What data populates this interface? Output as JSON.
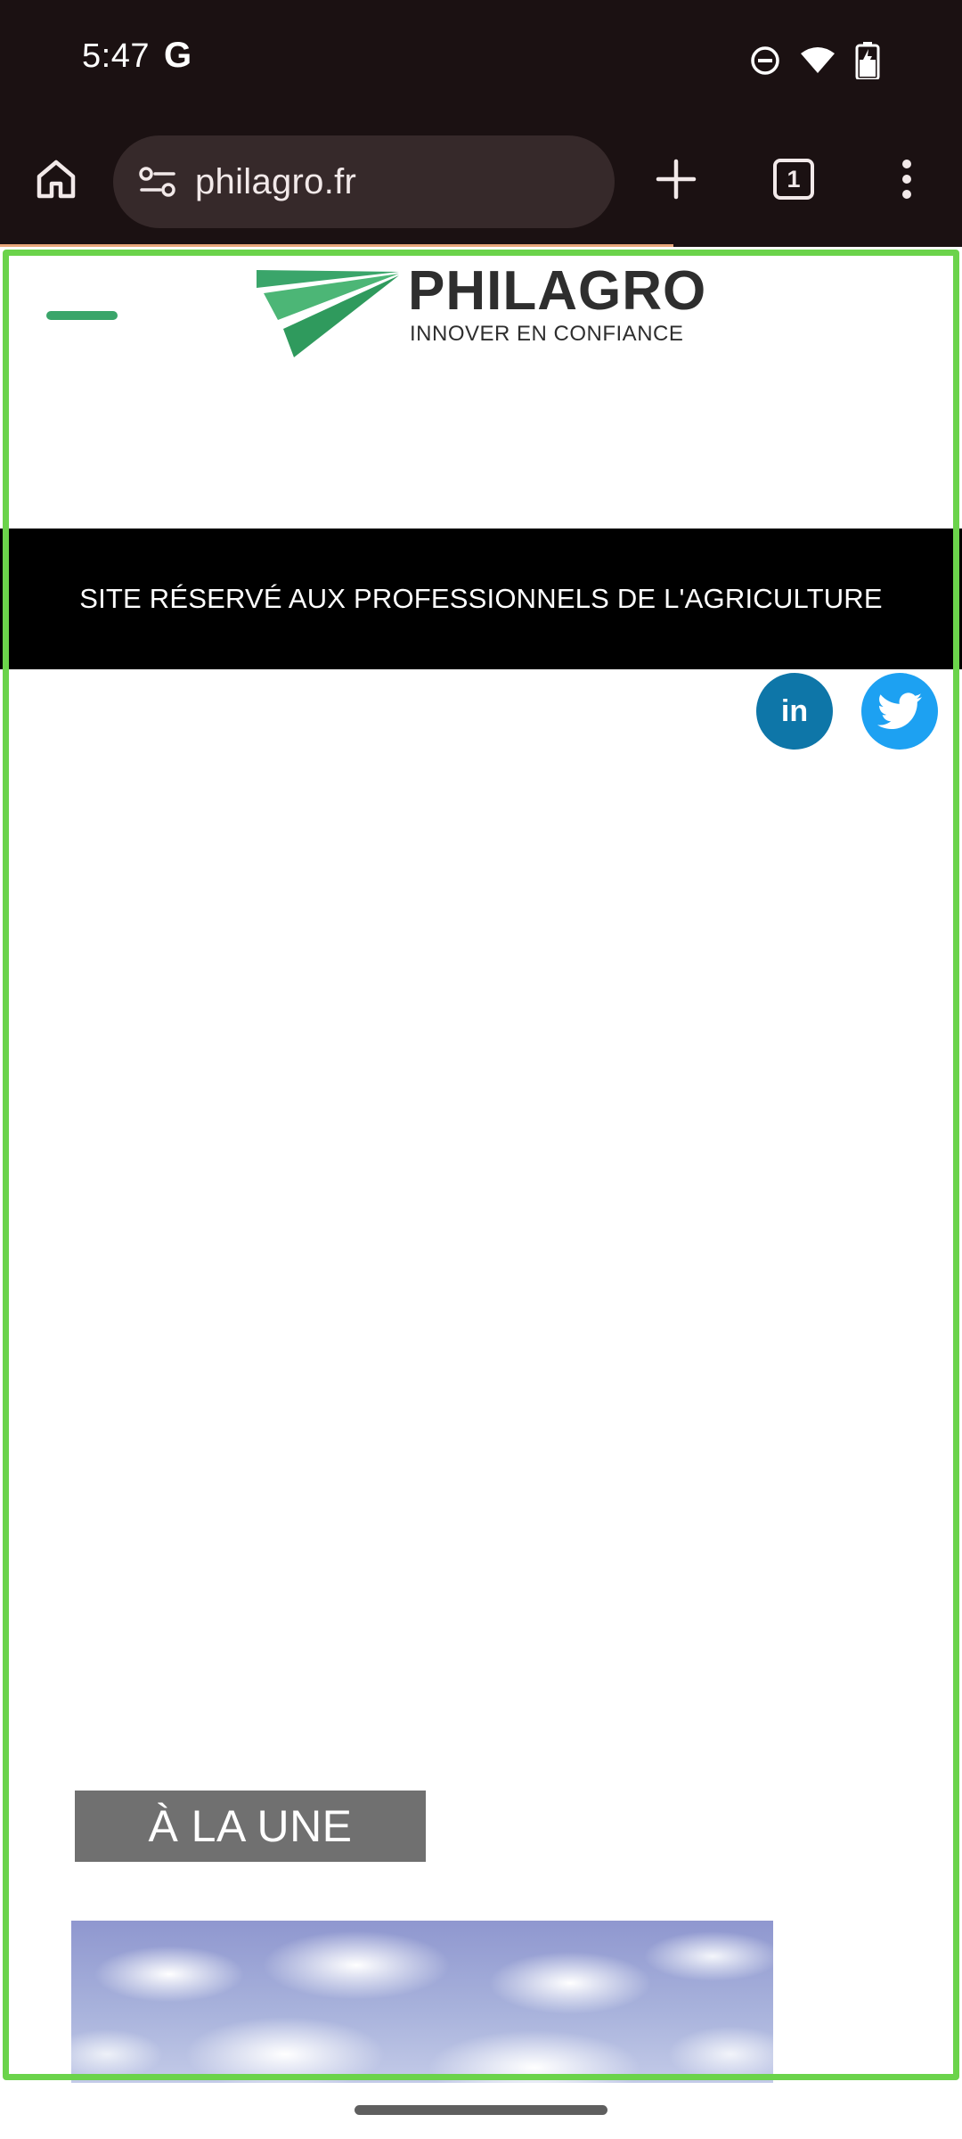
{
  "status_bar": {
    "time": "5:47",
    "google_glyph": "G",
    "icons": [
      "do-not-disturb-icon",
      "wifi-icon",
      "battery-charging-icon"
    ]
  },
  "browser": {
    "url": "philagro.fr",
    "tab_count": "1",
    "page_load_progress_percent": 70,
    "icons": [
      "home-icon",
      "site-settings-icon",
      "new-tab-plus-icon",
      "tab-switcher-icon",
      "more-menu-icon"
    ]
  },
  "site": {
    "logo_name": "PHILAGRO",
    "logo_tagline": "INNOVER EN CONFIANCE",
    "banner_text": "SITE RÉSERVÉ AUX PROFESSIONNELS DE L'AGRICULTURE",
    "linkedin_label": "in",
    "featured_label": "À LA UNE"
  },
  "colors": {
    "chrome_background": "#1b1112",
    "url_bar_background": "#36292a",
    "brand_green": "#3aa56a",
    "banner_background": "#000000",
    "linkedin_blue": "#0e76a8",
    "twitter_blue": "#1da1f2",
    "featured_badge_grey": "#707070",
    "focus_frame_green": "#6bd34b"
  }
}
